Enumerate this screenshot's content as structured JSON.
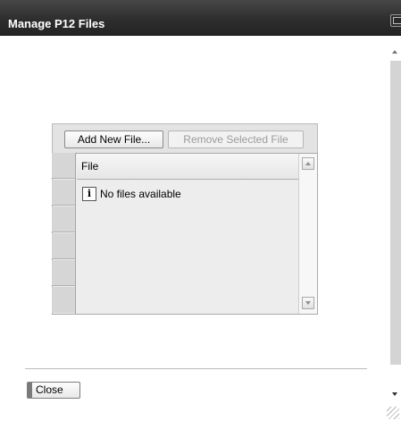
{
  "dialog": {
    "title": "Manage P12 Files"
  },
  "toolbar": {
    "add_label": "Add New File...",
    "remove_label": "Remove Selected File"
  },
  "table": {
    "columns": [
      "File"
    ],
    "empty_message": "No files available",
    "empty_icon": "info-icon"
  },
  "footer": {
    "close_label": "Close"
  },
  "colors": {
    "titlebar": "#2e2e2e",
    "panel": "#e3e3e3",
    "disabled_text": "#9b9b9b"
  }
}
